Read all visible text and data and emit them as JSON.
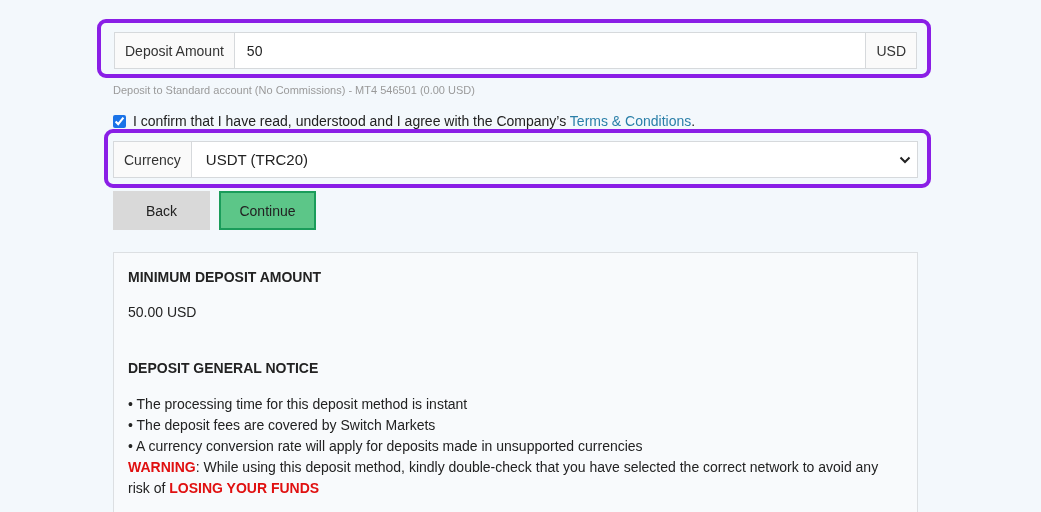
{
  "amount_field": {
    "label": "Deposit Amount",
    "value": "50",
    "suffix": "USD",
    "highlighted": true
  },
  "hint": "Deposit to Standard account (No Commissions) - MT4 546501 (0.00 USD)",
  "confirm": {
    "checked": true,
    "text": "I confirm that I have read, understood and I agree with the Company’s ",
    "link": "Terms & Conditions",
    "end": "."
  },
  "currency_field": {
    "label": "Currency",
    "value": "USDT (TRC20)",
    "highlighted": true
  },
  "buttons": [
    {
      "label": "Back",
      "kind": "secondary"
    },
    {
      "label": "Continue",
      "kind": "primary"
    }
  ],
  "notice": {
    "min_title": "MINIMUM DEPOSIT AMOUNT",
    "min_value": "50.00 USD",
    "general_title": "DEPOSIT GENERAL NOTICE",
    "bullets": [
      "• The processing time for this deposit method is instant",
      "• The deposit fees are covered by Switch Markets",
      "• A currency conversion rate will apply for deposits made in unsupported currencies"
    ],
    "warning": [
      {
        "text": "WARNING",
        "alert": true
      },
      {
        "text": ": While using this deposit method, kindly double-check that you have selected the correct network to avoid any risk of ",
        "alert": false
      },
      {
        "text": "LOSING YOUR FUNDS",
        "alert": true
      }
    ]
  }
}
